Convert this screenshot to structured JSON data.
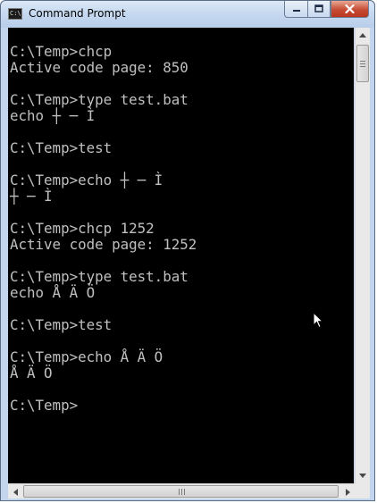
{
  "window": {
    "title": "Command Prompt",
    "icon": "console-app-icon",
    "icon_text": "C:\\",
    "controls": {
      "minimize_icon": "minimize-icon",
      "maximize_icon": "maximize-icon",
      "close_icon": "close-icon"
    }
  },
  "console": {
    "colors": {
      "background": "#000000",
      "text": "#c0c0c0"
    },
    "lines": [
      "",
      "C:\\Temp>chcp",
      "Active code page: 850",
      "",
      "C:\\Temp>type test.bat",
      "echo ┼ ─ Ì",
      "",
      "C:\\Temp>test",
      "",
      "C:\\Temp>echo ┼ ─ Ì",
      "┼ ─ Ì",
      "",
      "C:\\Temp>chcp 1252",
      "Active code page: 1252",
      "",
      "C:\\Temp>type test.bat",
      "echo Å Ä Ö",
      "",
      "C:\\Temp>test",
      "",
      "C:\\Temp>echo Å Ä Ö",
      "Å Ä Ö",
      "",
      "C:\\Temp>"
    ]
  },
  "scrollbars": {
    "up_icon": "scroll-up-arrow-icon",
    "down_icon": "scroll-down-arrow-icon",
    "left_icon": "scroll-left-arrow-icon",
    "right_icon": "scroll-right-arrow-icon"
  },
  "pointer": "mouse-pointer-icon"
}
